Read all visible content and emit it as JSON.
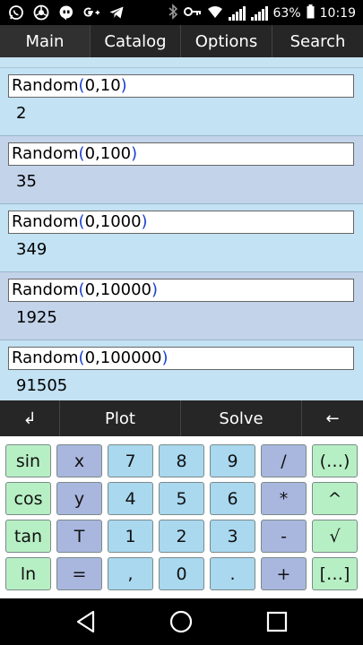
{
  "status": {
    "battery": "63%",
    "time": "10:19",
    "left_icons": [
      "whatsapp-icon",
      "chrome-icon",
      "hangouts-icon",
      "google-plus-icon",
      "telegram-icon"
    ],
    "right_icons": [
      "bluetooth-icon",
      "key-icon",
      "wifi-icon",
      "signal-icon",
      "signal-icon",
      "battery-icon"
    ]
  },
  "tabs": [
    {
      "label": "Main",
      "active": true
    },
    {
      "label": "Catalog",
      "active": false
    },
    {
      "label": "Options",
      "active": false
    },
    {
      "label": "Search",
      "active": false
    }
  ],
  "entries": [
    {
      "fn": "Random",
      "open": "(",
      "args": "0,10",
      "close": ")",
      "result": "2"
    },
    {
      "fn": "Random",
      "open": "(",
      "args": "0,100",
      "close": ")",
      "result": "35"
    },
    {
      "fn": "Random",
      "open": "(",
      "args": "0,1000",
      "close": ")",
      "result": "349"
    },
    {
      "fn": "Random",
      "open": "(",
      "args": "0,10000",
      "close": ")",
      "result": "1925"
    },
    {
      "fn": "Random",
      "open": "(",
      "args": "0,100000",
      "close": ")",
      "result": "91505"
    }
  ],
  "actions": {
    "enter": "↲",
    "plot": "Plot",
    "solve": "Solve",
    "backspace": "←"
  },
  "keypad": {
    "rows": [
      [
        "sin",
        "x",
        "7",
        "8",
        "9",
        "/",
        "(…)"
      ],
      [
        "cos",
        "y",
        "4",
        "5",
        "6",
        "*",
        "^"
      ],
      [
        "tan",
        "T",
        "1",
        "2",
        "3",
        "-",
        "√"
      ],
      [
        "ln",
        "=",
        ",",
        "0",
        ".",
        "+",
        "[…]"
      ]
    ]
  },
  "colors": {
    "key_green": "#b7efc4",
    "key_purple": "#a9b6de",
    "key_blue": "#a9d8ef",
    "paren_blue": "#1a3fd0",
    "entry_a": "#c3e2f3",
    "entry_b": "#c3d3ea"
  },
  "nav": {
    "icons": [
      "back-icon",
      "home-icon",
      "recents-icon"
    ]
  }
}
